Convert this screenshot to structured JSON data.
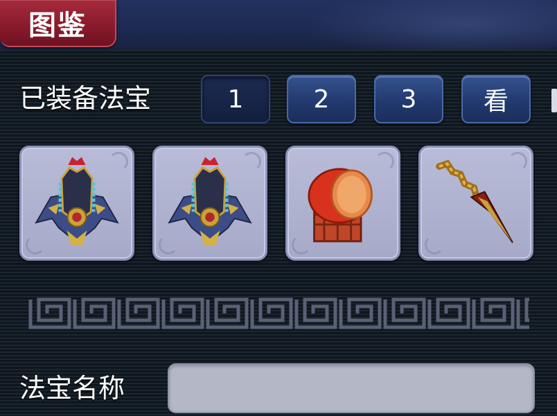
{
  "header": {
    "tab_title": "图鉴"
  },
  "equipped": {
    "label": "已装备法宝",
    "set_buttons": [
      {
        "label": "1",
        "active": true
      },
      {
        "label": "2",
        "active": false
      },
      {
        "label": "3",
        "active": false
      },
      {
        "label": "看",
        "active": false
      }
    ],
    "slots": [
      {
        "icon": "armor-icon"
      },
      {
        "icon": "armor-icon"
      },
      {
        "icon": "drum-icon"
      },
      {
        "icon": "dagger-icon"
      }
    ]
  },
  "treasure_name": {
    "label": "法宝名称",
    "value": ""
  },
  "colors": {
    "tab_red": "#8a1b2c",
    "button_blue": "#223a70",
    "slot_lavender": "#b0b4d2",
    "field_gray": "#b3b7c6"
  }
}
